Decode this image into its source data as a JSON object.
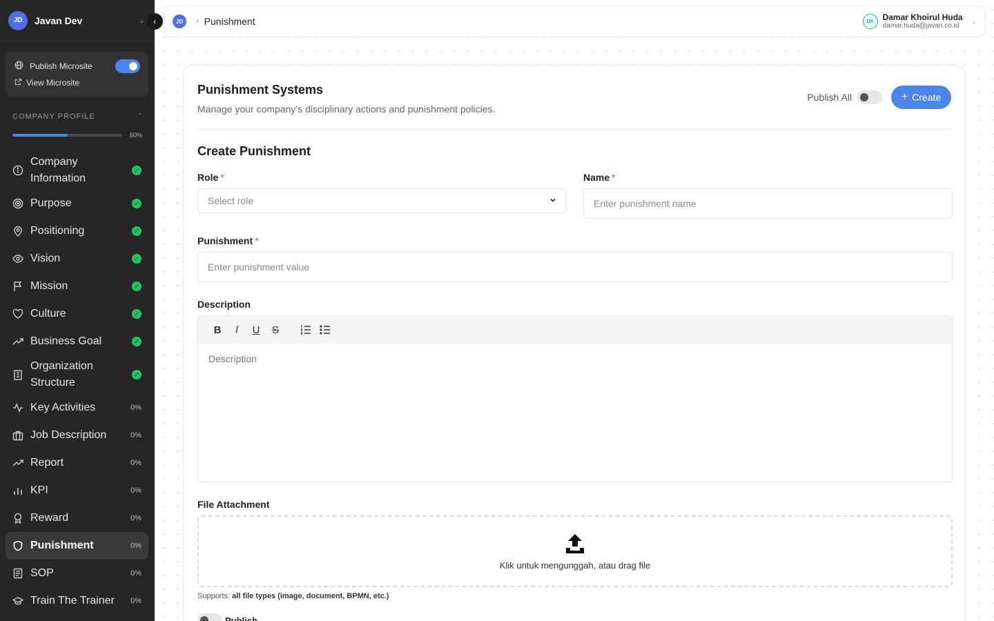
{
  "sidebar": {
    "workspace": {
      "initials": "JD",
      "name": "Javan Dev"
    },
    "publish_microsite": "Publish Microsite",
    "view_microsite": "View Microsite",
    "section_title": "COMPANY PROFILE",
    "progress": {
      "percent": 50,
      "label": "50%"
    },
    "items": [
      {
        "label": "Company Information",
        "status": "done"
      },
      {
        "label": "Purpose",
        "status": "done"
      },
      {
        "label": "Positioning",
        "status": "done"
      },
      {
        "label": "Vision",
        "status": "done"
      },
      {
        "label": "Mission",
        "status": "done"
      },
      {
        "label": "Culture",
        "status": "done"
      },
      {
        "label": "Business Goal",
        "status": "done"
      },
      {
        "label": "Organization Structure",
        "status": "done"
      },
      {
        "label": "Key Activities",
        "status": "0%"
      },
      {
        "label": "Job Description",
        "status": "0%"
      },
      {
        "label": "Report",
        "status": "0%"
      },
      {
        "label": "KPI",
        "status": "0%"
      },
      {
        "label": "Reward",
        "status": "0%"
      },
      {
        "label": "Punishment",
        "status": "0%"
      },
      {
        "label": "SOP",
        "status": "0%"
      },
      {
        "label": "Train The Trainer",
        "status": "0%"
      }
    ]
  },
  "topbar": {
    "avatar_initials": "JD",
    "breadcrumb": "Punishment",
    "user": {
      "initials": "DK",
      "name": "Damar Khoirul Huda",
      "email": "damar.huda@javan.co.id"
    }
  },
  "page": {
    "title": "Punishment Systems",
    "subtitle": "Manage your company's disciplinary actions and punishment policies.",
    "publish_all": "Publish All",
    "create_label": "Create"
  },
  "form": {
    "title": "Create Punishment",
    "role": {
      "label": "Role",
      "placeholder": "Select role"
    },
    "name": {
      "label": "Name",
      "placeholder": "Enter punishment name"
    },
    "punishment": {
      "label": "Punishment",
      "placeholder": "Enter punishment value"
    },
    "description": {
      "label": "Description",
      "placeholder": "Description"
    },
    "attachment": {
      "label": "File Attachment",
      "dropzone_text": "Klik untuk mengunggah, atau drag file",
      "supports_prefix": "Supports:",
      "supports_types": "all file types (image, document, BPMN, etc.)"
    },
    "publish_label": "Publish"
  },
  "colors": {
    "accent": "#4a86e8",
    "sidebar_bg": "#262626",
    "success": "#22c55e",
    "required": "#e5484d"
  }
}
